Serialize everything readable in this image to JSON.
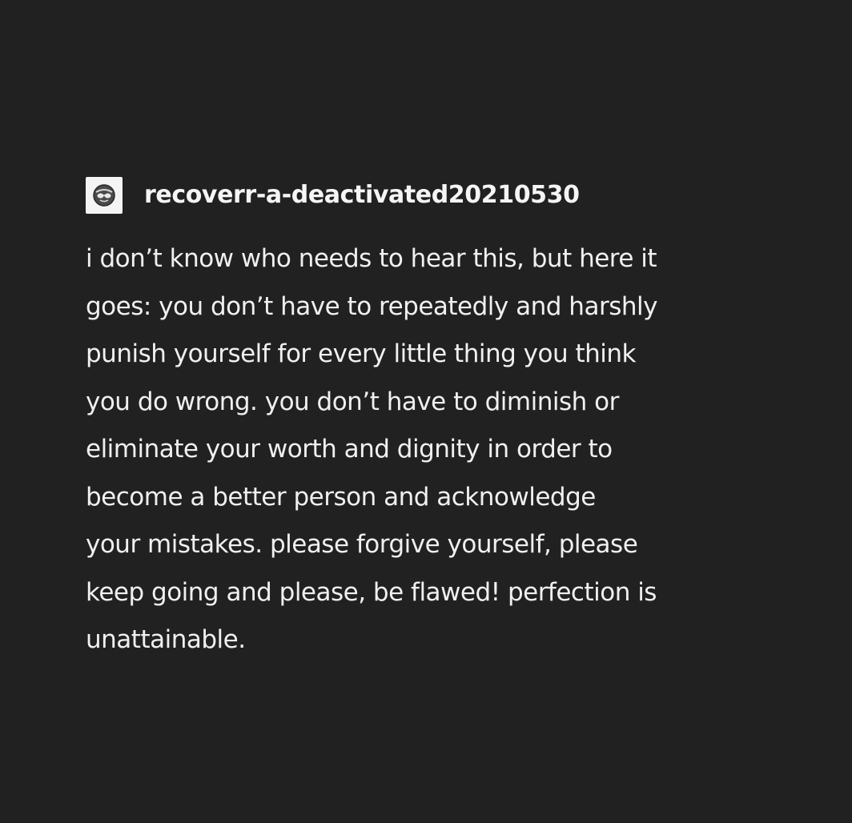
{
  "post": {
    "username": "recoverr-a-deactivated20210530",
    "avatar_icon": "sunglasses-face-icon",
    "body_lines": [
      "i don’t know who needs to hear this, but here it",
      "goes: you don’t have to repeatedly and harshly",
      "punish yourself for every little thing you think",
      "you do wrong. you don’t have to diminish or",
      "eliminate your worth and dignity in order to",
      "become a better person and acknowledge",
      "your mistakes. please forgive yourself, please",
      "keep going and please, be flawed! perfection is",
      "unattainable."
    ]
  },
  "colors": {
    "background": "#212121",
    "text": "#f0f0f0",
    "avatar_background": "#f4f4f4"
  }
}
